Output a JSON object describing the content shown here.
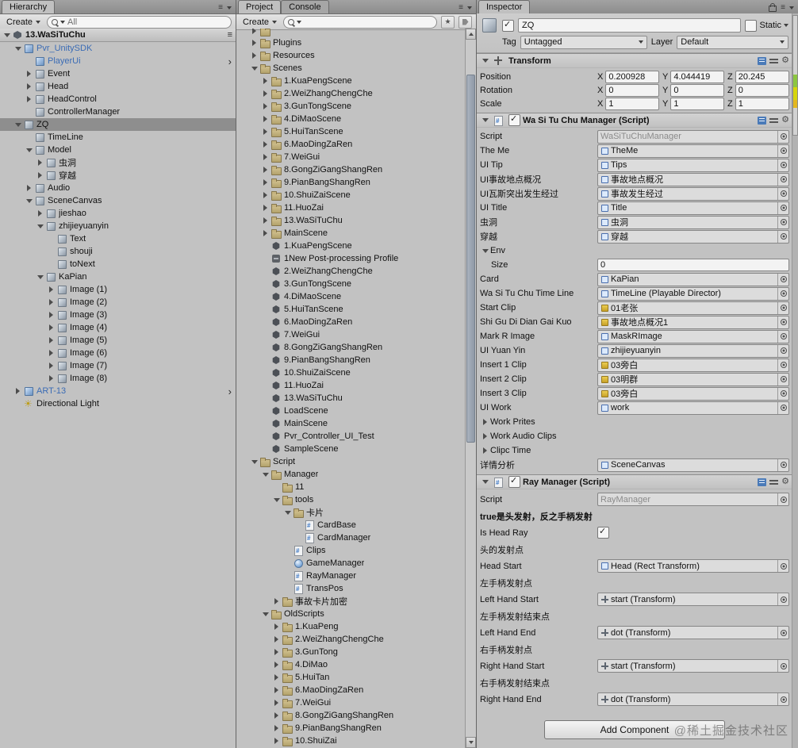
{
  "watermark": "@稀土掘金技术社区",
  "icons": {
    "menu": "≡",
    "chevron": "›",
    "gear": "⚙",
    "star": "★"
  },
  "colors": {
    "prefab_text": "#3b6cb5",
    "selection": "#8e8e8e",
    "folder": "#b3a26c",
    "clip_icon": "#c7a128",
    "scroll_marker_green": "#8cc63f",
    "scroll_marker_yellow": "#d6d60a"
  },
  "hierarchy": {
    "tab": "Hierarchy",
    "create_label": "Create",
    "search_text": "All",
    "rows": [
      {
        "label": "13.WaSiTuChu",
        "depth": 0,
        "arrow": "open",
        "icon": "scene",
        "scene_header": true,
        "menu": true
      },
      {
        "label": "Pvr_UnitySDK",
        "depth": 1,
        "arrow": "open",
        "icon": "cube-blue",
        "prefab": true
      },
      {
        "label": "PlayerUi",
        "depth": 2,
        "arrow": "none",
        "icon": "cube-blue",
        "prefab": true,
        "chevron": true
      },
      {
        "label": "Event",
        "depth": 2,
        "arrow": "closed",
        "icon": "cube"
      },
      {
        "label": "Head",
        "depth": 2,
        "arrow": "closed",
        "icon": "cube"
      },
      {
        "label": "HeadControl",
        "depth": 2,
        "arrow": "closed",
        "icon": "cube"
      },
      {
        "label": "ControllerManager",
        "depth": 2,
        "arrow": "none",
        "icon": "cube"
      },
      {
        "label": "ZQ",
        "depth": 1,
        "arrow": "open",
        "icon": "cube",
        "selected": true
      },
      {
        "label": "TimeLine",
        "depth": 2,
        "arrow": "none",
        "icon": "cube"
      },
      {
        "label": "Model",
        "depth": 2,
        "arrow": "open",
        "icon": "cube"
      },
      {
        "label": "虫洞",
        "depth": 3,
        "arrow": "closed",
        "icon": "cube"
      },
      {
        "label": "穿越",
        "depth": 3,
        "arrow": "closed",
        "icon": "cube"
      },
      {
        "label": "Audio",
        "depth": 2,
        "arrow": "closed",
        "icon": "cube"
      },
      {
        "label": "SceneCanvas",
        "depth": 2,
        "arrow": "open",
        "icon": "cube"
      },
      {
        "label": "jieshao",
        "depth": 3,
        "arrow": "closed",
        "icon": "cube"
      },
      {
        "label": "zhijieyuanyin",
        "depth": 3,
        "arrow": "open",
        "icon": "cube"
      },
      {
        "label": "Text",
        "depth": 4,
        "arrow": "none",
        "icon": "cube"
      },
      {
        "label": "shouji",
        "depth": 4,
        "arrow": "none",
        "icon": "cube"
      },
      {
        "label": "toNext",
        "depth": 4,
        "arrow": "none",
        "icon": "cube"
      },
      {
        "label": "KaPian",
        "depth": 3,
        "arrow": "open",
        "icon": "cube"
      },
      {
        "label": "Image (1)",
        "depth": 4,
        "arrow": "closed",
        "icon": "cube"
      },
      {
        "label": "Image (2)",
        "depth": 4,
        "arrow": "closed",
        "icon": "cube"
      },
      {
        "label": "Image (3)",
        "depth": 4,
        "arrow": "closed",
        "icon": "cube"
      },
      {
        "label": "Image (4)",
        "depth": 4,
        "arrow": "closed",
        "icon": "cube"
      },
      {
        "label": "Image (5)",
        "depth": 4,
        "arrow": "closed",
        "icon": "cube"
      },
      {
        "label": "Image (6)",
        "depth": 4,
        "arrow": "closed",
        "icon": "cube"
      },
      {
        "label": "Image (7)",
        "depth": 4,
        "arrow": "closed",
        "icon": "cube"
      },
      {
        "label": "Image (8)",
        "depth": 4,
        "arrow": "closed",
        "icon": "cube"
      },
      {
        "label": "ART-13",
        "depth": 1,
        "arrow": "closed",
        "icon": "cube-blue",
        "prefab": true,
        "chevron": true
      },
      {
        "label": "Directional Light",
        "depth": 1,
        "arrow": "none",
        "icon": "light"
      }
    ]
  },
  "project": {
    "tabs": [
      {
        "label": "Project",
        "active": true
      },
      {
        "label": "Console",
        "active": false
      }
    ],
    "create_label": "Create",
    "search_text": "",
    "rows": [
      {
        "label": "",
        "depth": 1,
        "arrow": "closed",
        "icon": "folder",
        "clipped": true
      },
      {
        "label": "Plugins",
        "depth": 1,
        "arrow": "closed",
        "icon": "folder"
      },
      {
        "label": "Resources",
        "depth": 1,
        "arrow": "closed",
        "icon": "folder"
      },
      {
        "label": "Scenes",
        "depth": 1,
        "arrow": "open",
        "icon": "folder"
      },
      {
        "label": "1.KuaPengScene",
        "depth": 2,
        "arrow": "closed",
        "icon": "folder"
      },
      {
        "label": "2.WeiZhangChengChe",
        "depth": 2,
        "arrow": "closed",
        "icon": "folder"
      },
      {
        "label": "3.GunTongScene",
        "depth": 2,
        "arrow": "closed",
        "icon": "folder"
      },
      {
        "label": "4.DiMaoScene",
        "depth": 2,
        "arrow": "closed",
        "icon": "folder"
      },
      {
        "label": "5.HuiTanScene",
        "depth": 2,
        "arrow": "closed",
        "icon": "folder"
      },
      {
        "label": "6.MaoDingZaRen",
        "depth": 2,
        "arrow": "closed",
        "icon": "folder"
      },
      {
        "label": "7.WeiGui",
        "depth": 2,
        "arrow": "closed",
        "icon": "folder"
      },
      {
        "label": "8.GongZiGangShangRen",
        "depth": 2,
        "arrow": "closed",
        "icon": "folder"
      },
      {
        "label": "9.PianBangShangRen",
        "depth": 2,
        "arrow": "closed",
        "icon": "folder"
      },
      {
        "label": "10.ShuiZaiScene",
        "depth": 2,
        "arrow": "closed",
        "icon": "folder"
      },
      {
        "label": "11.HuoZai",
        "depth": 2,
        "arrow": "closed",
        "icon": "folder"
      },
      {
        "label": "13.WaSiTuChu",
        "depth": 2,
        "arrow": "closed",
        "icon": "folder"
      },
      {
        "label": "MainScene",
        "depth": 2,
        "arrow": "closed",
        "icon": "folder"
      },
      {
        "label": "1.KuaPengScene",
        "depth": 2,
        "arrow": "none",
        "icon": "scenefile"
      },
      {
        "label": "1New Post-processing Profile",
        "depth": 2,
        "arrow": "none",
        "icon": "profile"
      },
      {
        "label": "2.WeiZhangChengChe",
        "depth": 2,
        "arrow": "none",
        "icon": "scenefile"
      },
      {
        "label": "3.GunTongScene",
        "depth": 2,
        "arrow": "none",
        "icon": "scenefile"
      },
      {
        "label": "4.DiMaoScene",
        "depth": 2,
        "arrow": "none",
        "icon": "scenefile"
      },
      {
        "label": "5.HuiTanScene",
        "depth": 2,
        "arrow": "none",
        "icon": "scenefile"
      },
      {
        "label": "6.MaoDingZaRen",
        "depth": 2,
        "arrow": "none",
        "icon": "scenefile"
      },
      {
        "label": "7.WeiGui",
        "depth": 2,
        "arrow": "none",
        "icon": "scenefile"
      },
      {
        "label": "8.GongZiGangShangRen",
        "depth": 2,
        "arrow": "none",
        "icon": "scenefile"
      },
      {
        "label": "9.PianBangShangRen",
        "depth": 2,
        "arrow": "none",
        "icon": "scenefile"
      },
      {
        "label": "10.ShuiZaiScene",
        "depth": 2,
        "arrow": "none",
        "icon": "scenefile"
      },
      {
        "label": "11.HuoZai",
        "depth": 2,
        "arrow": "none",
        "icon": "scenefile"
      },
      {
        "label": "13.WaSiTuChu",
        "depth": 2,
        "arrow": "none",
        "icon": "scenefile"
      },
      {
        "label": "LoadScene",
        "depth": 2,
        "arrow": "none",
        "icon": "scenefile"
      },
      {
        "label": "MainScene",
        "depth": 2,
        "arrow": "none",
        "icon": "scenefile"
      },
      {
        "label": "Pvr_Controller_UI_Test",
        "depth": 2,
        "arrow": "none",
        "icon": "scenefile"
      },
      {
        "label": "SampleScene",
        "depth": 2,
        "arrow": "none",
        "icon": "scenefile"
      },
      {
        "label": "Script",
        "depth": 1,
        "arrow": "open",
        "icon": "folder"
      },
      {
        "label": "Manager",
        "depth": 2,
        "arrow": "open",
        "icon": "folder"
      },
      {
        "label": "11",
        "depth": 3,
        "arrow": "none",
        "icon": "folder"
      },
      {
        "label": "tools",
        "depth": 3,
        "arrow": "open",
        "icon": "folder"
      },
      {
        "label": "卡片",
        "depth": 4,
        "arrow": "open",
        "icon": "folder"
      },
      {
        "label": "CardBase",
        "depth": 5,
        "arrow": "none",
        "icon": "script"
      },
      {
        "label": "CardManager",
        "depth": 5,
        "arrow": "none",
        "icon": "script"
      },
      {
        "label": "Clips",
        "depth": 4,
        "arrow": "none",
        "icon": "script"
      },
      {
        "label": "GameManager",
        "depth": 4,
        "arrow": "none",
        "icon": "asset"
      },
      {
        "label": "RayManager",
        "depth": 4,
        "arrow": "none",
        "icon": "script"
      },
      {
        "label": "TransPos",
        "depth": 4,
        "arrow": "none",
        "icon": "script"
      },
      {
        "label": "事故卡片加密",
        "depth": 3,
        "arrow": "closed",
        "icon": "folder"
      },
      {
        "label": "OldScripts",
        "depth": 2,
        "arrow": "open",
        "icon": "folder"
      },
      {
        "label": "1.KuaPeng",
        "depth": 3,
        "arrow": "closed",
        "icon": "folder"
      },
      {
        "label": "2.WeiZhangChengChe",
        "depth": 3,
        "arrow": "closed",
        "icon": "folder"
      },
      {
        "label": "3.GunTong",
        "depth": 3,
        "arrow": "closed",
        "icon": "folder"
      },
      {
        "label": "4.DiMao",
        "depth": 3,
        "arrow": "closed",
        "icon": "folder"
      },
      {
        "label": "5.HuiTan",
        "depth": 3,
        "arrow": "closed",
        "icon": "folder"
      },
      {
        "label": "6.MaoDingZaRen",
        "depth": 3,
        "arrow": "closed",
        "icon": "folder"
      },
      {
        "label": "7.WeiGui",
        "depth": 3,
        "arrow": "closed",
        "icon": "folder"
      },
      {
        "label": "8.GongZiGangShangRen",
        "depth": 3,
        "arrow": "closed",
        "icon": "folder"
      },
      {
        "label": "9.PianBangShangRen",
        "depth": 3,
        "arrow": "closed",
        "icon": "folder"
      },
      {
        "label": "10.ShuiZai",
        "depth": 3,
        "arrow": "closed",
        "icon": "folder"
      }
    ]
  },
  "inspector": {
    "tab": "Inspector",
    "gameobject": {
      "name": "ZQ",
      "static_label": "Static",
      "tag_label": "Tag",
      "tag_value": "Untagged",
      "layer_label": "Layer",
      "layer_value": "Default"
    },
    "transform": {
      "title": "Transform",
      "axes": [
        "X",
        "Y",
        "Z"
      ],
      "rows": [
        {
          "label": "Position",
          "values": [
            "0.200928",
            "4.044419",
            "20.245"
          ]
        },
        {
          "label": "Rotation",
          "values": [
            "0",
            "0",
            "0"
          ]
        },
        {
          "label": "Scale",
          "values": [
            "1",
            "1",
            "1"
          ]
        }
      ]
    },
    "components": [
      {
        "title": "Wa Si Tu Chu Manager (Script)",
        "enabled": true,
        "rows": [
          {
            "t": "object",
            "label": "Script",
            "value": "WaSiTuChuManager",
            "muted": true
          },
          {
            "t": "object",
            "label": "The Me",
            "value": "TheMe",
            "vicon": "rect"
          },
          {
            "t": "object",
            "label": "UI Tip",
            "value": "Tips",
            "vicon": "rect"
          },
          {
            "t": "object",
            "label": "UI事故地点概况",
            "value": "事故地点概况",
            "vicon": "rect"
          },
          {
            "t": "object",
            "label": "UI瓦斯突出发生经过",
            "value": "事故发生经过",
            "vicon": "rect"
          },
          {
            "t": "object",
            "label": "UI Title",
            "value": "Title",
            "vicon": "rect"
          },
          {
            "t": "object",
            "label": "虫洞",
            "value": "虫洞",
            "vicon": "rect"
          },
          {
            "t": "object",
            "label": "穿越",
            "value": "穿越",
            "vicon": "rect"
          },
          {
            "t": "foldout",
            "label": "Env",
            "open": true
          },
          {
            "t": "text",
            "label": "Size",
            "value": "0",
            "indent": 1
          },
          {
            "t": "object",
            "label": "Card",
            "value": "KaPian",
            "vicon": "rect"
          },
          {
            "t": "object",
            "label": "Wa Si Tu Chu Time Line",
            "value": "TimeLine (Playable Director)",
            "vicon": "rect"
          },
          {
            "t": "object",
            "label": "Start Clip",
            "value": "01老张",
            "vicon": "clip"
          },
          {
            "t": "object",
            "label": "Shi Gu Di Dian Gai Kuo",
            "value": "事故地点概况1",
            "vicon": "clip"
          },
          {
            "t": "object",
            "label": "Mark R Image",
            "value": "MaskRImage",
            "vicon": "rect"
          },
          {
            "t": "object",
            "label": "UI Yuan Yin",
            "value": "zhijieyuanyin",
            "vicon": "rect"
          },
          {
            "t": "object",
            "label": "Insert 1 Clip",
            "value": "03旁白",
            "vicon": "clip"
          },
          {
            "t": "object",
            "label": "Insert 2 Clip",
            "value": "03明群",
            "vicon": "clip"
          },
          {
            "t": "object",
            "label": "Insert 3 Clip",
            "value": "03旁白",
            "vicon": "clip"
          },
          {
            "t": "object",
            "label": "UI Work",
            "value": "work",
            "vicon": "rect"
          },
          {
            "t": "foldout",
            "label": "Work Prites",
            "open": false
          },
          {
            "t": "foldout",
            "label": "Work Audio Clips",
            "open": false
          },
          {
            "t": "foldout",
            "label": "Clipc Time",
            "open": false
          },
          {
            "t": "object",
            "label": "详情分析",
            "value": "SceneCanvas",
            "vicon": "rect"
          }
        ]
      },
      {
        "title": "Ray Manager (Script)",
        "enabled": true,
        "rows": [
          {
            "t": "object",
            "label": "Script",
            "value": "RayManager",
            "muted": true
          },
          {
            "t": "boldlabel",
            "label": "true是头发射，反之手柄发射"
          },
          {
            "t": "checkbox",
            "label": "Is Head Ray",
            "checked": true
          },
          {
            "t": "label",
            "label": "头的发射点"
          },
          {
            "t": "object",
            "label": "Head Start",
            "value": "Head (Rect Transform)",
            "vicon": "rect"
          },
          {
            "t": "label",
            "label": "左手柄发射点"
          },
          {
            "t": "object",
            "label": "Left Hand Start",
            "value": "start (Transform)",
            "vicon": "tmini"
          },
          {
            "t": "label",
            "label": "左手柄发射结束点"
          },
          {
            "t": "object",
            "label": "Left Hand End",
            "value": "dot (Transform)",
            "vicon": "tmini"
          },
          {
            "t": "label",
            "label": "右手柄发射点"
          },
          {
            "t": "object",
            "label": "Right Hand Start",
            "value": "start (Transform)",
            "vicon": "tmini"
          },
          {
            "t": "label",
            "label": "右手柄发射结束点"
          },
          {
            "t": "object",
            "label": "Right Hand End",
            "value": "dot (Transform)",
            "vicon": "tmini"
          }
        ]
      }
    ],
    "add_component_label": "Add Component"
  }
}
